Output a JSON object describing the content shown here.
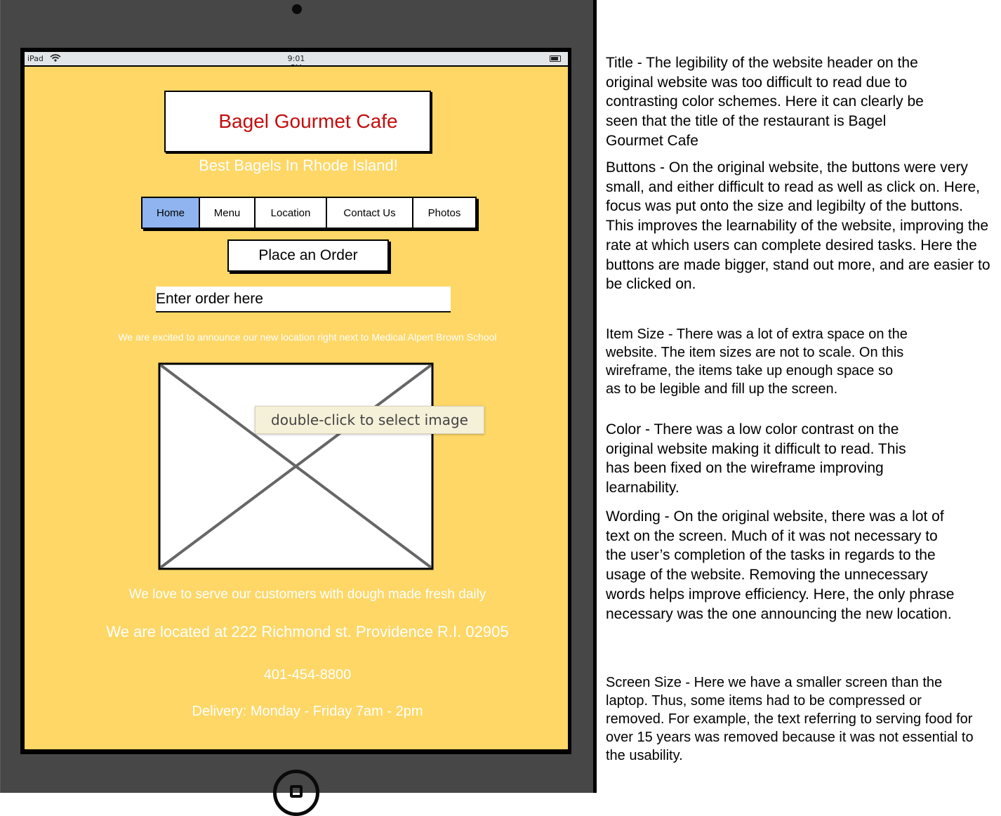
{
  "device": {
    "status_left": "iPad",
    "status_time": "9:01 PM"
  },
  "site": {
    "title": "Bagel Gourmet Cafe",
    "tagline": "Best Bagels In Rhode Island!",
    "nav": [
      "Home",
      "Menu",
      "Location",
      "Contact Us",
      "Photos"
    ],
    "order_button": "Place an Order",
    "order_placeholder": "Enter order here",
    "announcement": "We are excited to announce our new location right next to Medical Alpert Brown School",
    "image_tooltip": "double-click to select image",
    "dough": "We love to serve our customers with dough made fresh daily",
    "address": "We are located at 222 Richmond st. Providence R.I. 02905",
    "phone": "401-454-8800",
    "delivery": "Delivery: Monday - Friday 7am - 2pm"
  },
  "notes": [
    "Title - The legibility of the website header on the original website was too difficult to read due to contrasting color schemes. Here it can clearly be seen that the title of the restaurant is Bagel Gourmet Cafe",
    "Buttons - On the original website, the buttons were very small, and either difficult to read as well as click on. Here, focus was put onto the size and legibilty of the buttons. This improves the learnability of the website, improving the rate at which users can complete desired tasks. Here the buttons are made bigger, stand out more, and are easier to be clicked on.",
    "Item Size - There was a lot of extra space on the website. The item sizes are not to scale. On this wireframe, the items take up enough space so as to be legible and fill up the screen.",
    "Color - There was a low color contrast on the original website making it difficult to read. This has been fixed on the wireframe improving learnability.",
    "Wording - On the original website, there was a lot of text on the screen. Much of it was not necessary to the user’s completion of the tasks in regards to the usage of the website. Removing the unnecessary words helps improve efficiency. Here, the only phrase necessary was the one announcing the new location.",
    "Screen Size - Here we have a smaller screen than the laptop. Thus, some items had to be compressed or removed. For example, the text referring to serving food for over 15 years was removed because it was not essential to the usability."
  ]
}
